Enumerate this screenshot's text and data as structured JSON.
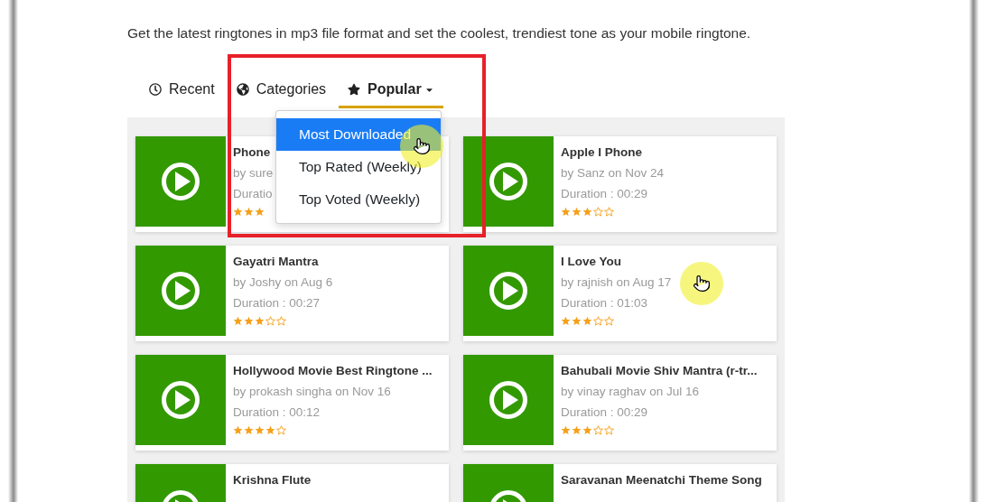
{
  "intro": "Get the latest ringtones in mp3 file format and set the coolest, trendiest tone as your mobile ringtone.",
  "tabs": [
    {
      "label": "Recent",
      "kind": "link",
      "selected": false
    },
    {
      "label": "Categories",
      "kind": "link",
      "selected": false
    },
    {
      "label": "Popular",
      "kind": "dropdown",
      "selected": true
    }
  ],
  "dropdown": {
    "items": [
      {
        "label": "Most Downloaded",
        "selected": true
      },
      {
        "label": "Top Rated (Weekly)",
        "selected": false
      },
      {
        "label": "Top Voted (Weekly)",
        "selected": false
      }
    ]
  },
  "ringtones": [
    {
      "title": "Phone",
      "byline": "by sure",
      "duration": "Duratio",
      "stars": 3,
      "covered": true
    },
    {
      "title": "Apple I Phone",
      "byline": "by Sanz on Nov 24",
      "duration": "Duration : 00:29",
      "stars": 3
    },
    {
      "title": "Gayatri Mantra",
      "byline": "by Joshy on Aug 6",
      "duration": "Duration : 00:27",
      "stars": 3
    },
    {
      "title": "I Love You",
      "byline": "by rajnish on Aug 17",
      "duration": "Duration : 01:03",
      "stars": 3
    },
    {
      "title": "Hollywood Movie Best Ringtone ...",
      "byline": "by prokash singha on Nov 16",
      "duration": "Duration : 00:12",
      "stars": 4
    },
    {
      "title": "Bahubali Movie Shiv Mantra (r-tr...",
      "byline": "by vinay raghav on Jul 16",
      "duration": "Duration : 00:29",
      "stars": 3
    },
    {
      "title": "Krishna Flute"
    },
    {
      "title": "Saravanan Meenatchi Theme Song"
    }
  ]
}
